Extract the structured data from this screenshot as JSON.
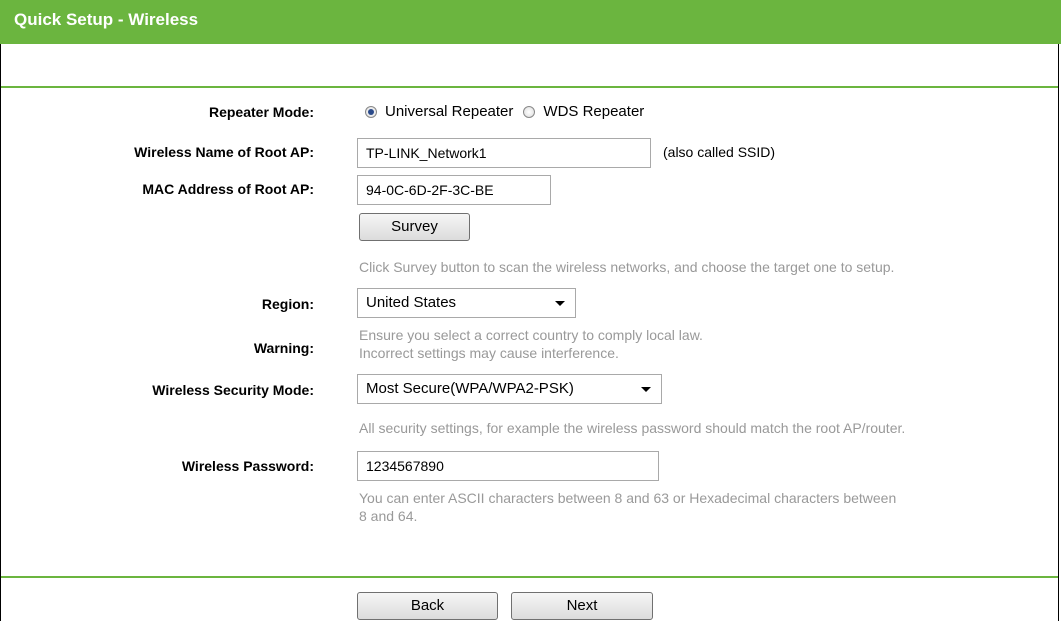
{
  "page": {
    "title": "Quick Setup - Wireless"
  },
  "form": {
    "repeater_mode": {
      "label": "Repeater Mode:",
      "options": [
        "Universal Repeater",
        "WDS Repeater"
      ],
      "selected": "Universal Repeater"
    },
    "root_ssid": {
      "label": "Wireless Name of Root AP:",
      "value": "TP-LINK_Network1",
      "hint": "(also called SSID)"
    },
    "root_mac": {
      "label": "MAC Address of Root AP:",
      "value": "94-0C-6D-2F-3C-BE"
    },
    "survey": {
      "button_label": "Survey",
      "hint": "Click Survey button to scan the wireless networks, and choose the target one to setup."
    },
    "region": {
      "label": "Region:",
      "value": "United States"
    },
    "warning": {
      "label": "Warning:",
      "line1": "Ensure you select a correct country to comply local law.",
      "line2": "Incorrect settings may cause interference."
    },
    "security_mode": {
      "label": "Wireless Security Mode:",
      "value": "Most Secure(WPA/WPA2-PSK)",
      "hint": "All security settings, for example the wireless password should match the root AP/router."
    },
    "password": {
      "label": "Wireless Password:",
      "value": "1234567890",
      "hint_line1": "You can enter ASCII characters between 8 and 63 or Hexadecimal characters between",
      "hint_line2": "8 and 64."
    }
  },
  "footer": {
    "back_label": "Back",
    "next_label": "Next"
  },
  "colors": {
    "accent": "#6bb53f",
    "hint_text": "#999999"
  }
}
